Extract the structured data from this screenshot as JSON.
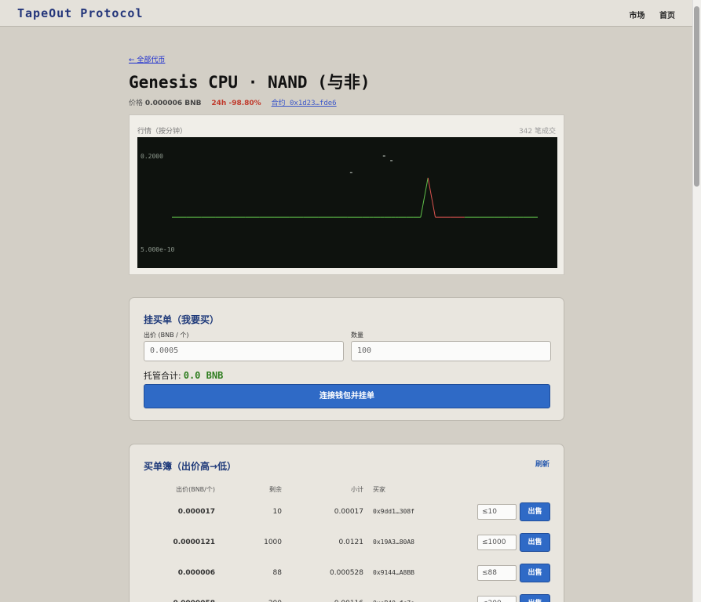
{
  "header": {
    "brand": "TapeOut Protocol",
    "nav": [
      "市场",
      "首页"
    ]
  },
  "token": {
    "back_link": "← 全部代币",
    "title": "Genesis CPU · NAND (与非)",
    "price_label": "价格",
    "price_value": "0.000006 BNB",
    "change_24h": "24h -98.80%",
    "contract": "合约 0x1d23…fde6"
  },
  "chart_panel": {
    "label": "行情（按分钟）",
    "trades": "342 笔成交"
  },
  "chart_data": {
    "type": "line",
    "y_tick_labels": [
      "0.2000",
      "5.000e-10"
    ],
    "colors": {
      "up": "#5fbf4a",
      "down": "#d9534f",
      "background": "#0e120e"
    },
    "x": [
      0,
      4,
      8,
      12,
      16,
      20,
      24,
      28,
      32,
      36,
      40,
      44,
      48,
      50,
      52,
      54,
      55,
      57,
      58,
      60,
      61,
      62,
      64,
      66,
      68,
      70,
      72,
      76,
      80,
      84,
      88,
      92,
      96,
      100
    ],
    "values": [
      5e-07,
      5e-07,
      5e-07,
      5e-07,
      5e-07,
      5e-07,
      5e-07,
      5e-07,
      5e-07,
      5e-07,
      5e-07,
      5e-07,
      5e-07,
      5e-07,
      5e-07,
      5e-07,
      5e-07,
      5e-07,
      5e-07,
      5e-07,
      5e-07,
      5e-07,
      5e-07,
      5e-07,
      5e-07,
      0.002,
      5e-07,
      5e-07,
      5e-07,
      5e-07,
      5e-07,
      5e-07,
      5e-07,
      5e-07
    ],
    "spikes": [
      {
        "x": 58,
        "value": 0.2
      },
      {
        "x": 60,
        "value": 0.075
      },
      {
        "x": 49,
        "value": 0.006
      }
    ],
    "ylim": [
      5e-10,
      0.2
    ]
  },
  "buy_panel": {
    "title": "挂买单（我要买）",
    "price_label": "出价 (BNB / 个)",
    "price_placeholder": "0.0005",
    "qty_label": "数量",
    "qty_placeholder": "100",
    "total_label": "托管合计:",
    "total_value": "0.0 BNB",
    "submit_label": "连接钱包并挂单"
  },
  "order_book": {
    "title": "买单簿（出价高→低）",
    "refresh_label": "刷新",
    "columns": [
      "出价(BNB/个)",
      "剩余",
      "小计",
      "买家"
    ],
    "sell_label": "出售",
    "rows": [
      {
        "price": "0.000017",
        "remaining": "10",
        "subtotal": "0.00017",
        "buyer": "0x9dd1…308f",
        "qty_placeholder": "≤10"
      },
      {
        "price": "0.0000121",
        "remaining": "1000",
        "subtotal": "0.0121",
        "buyer": "0x19A3…80A8",
        "qty_placeholder": "≤1000"
      },
      {
        "price": "0.000006",
        "remaining": "88",
        "subtotal": "0.000528",
        "buyer": "0x9144…A8BB",
        "qty_placeholder": "≤88"
      },
      {
        "price": "0.0000058",
        "remaining": "200",
        "subtotal": "0.00116",
        "buyer": "0xeB40…fc7e",
        "qty_placeholder": "≤200"
      }
    ]
  }
}
